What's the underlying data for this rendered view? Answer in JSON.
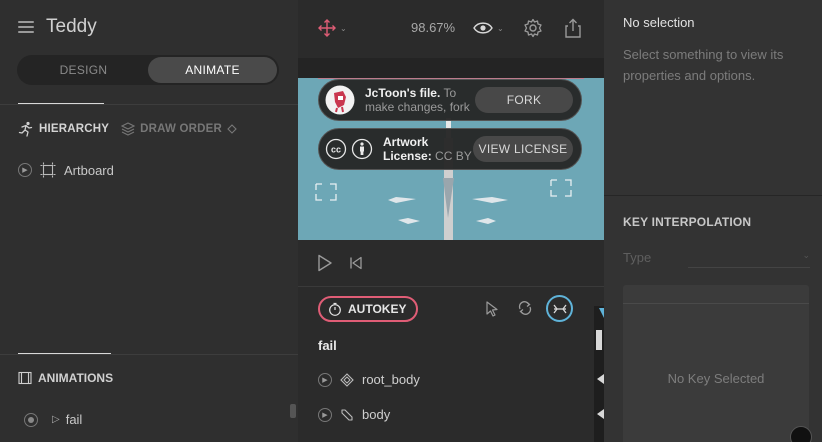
{
  "app": {
    "title": "Teddy"
  },
  "mode_switch": {
    "design": "DESIGN",
    "animate": "ANIMATE",
    "active": "animate"
  },
  "panel_tabs": {
    "hierarchy": "HIERARCHY",
    "draw_order": "DRAW ORDER"
  },
  "hierarchy": {
    "items": [
      {
        "label": "Artboard"
      }
    ]
  },
  "animations": {
    "header": "ANIMATIONS",
    "items": [
      {
        "label": "fail"
      }
    ]
  },
  "toolbar": {
    "zoom": "98.67%"
  },
  "banners": {
    "file": {
      "title": "JcToon's file.",
      "text": "To make changes, fork",
      "button": "FORK"
    },
    "license": {
      "title": "Artwork",
      "label": "License:",
      "value": "CC BY",
      "button": "VIEW LICENSE"
    }
  },
  "timeline": {
    "autokey": "AUTOKEY",
    "animation_name": "fail",
    "rows": [
      {
        "label": "root_body",
        "icon": "bone-diamond-icon"
      },
      {
        "label": "body",
        "icon": "bone-icon"
      }
    ]
  },
  "inspector": {
    "title": "No selection",
    "description": "Select something to view its properties and options.",
    "key_interpolation": "KEY INTERPOLATION",
    "type_label": "Type",
    "empty_message": "No Key Selected"
  },
  "colors": {
    "accent": "#e05d76",
    "stage": "#6da7b6",
    "highlight": "#5fb3d9"
  }
}
